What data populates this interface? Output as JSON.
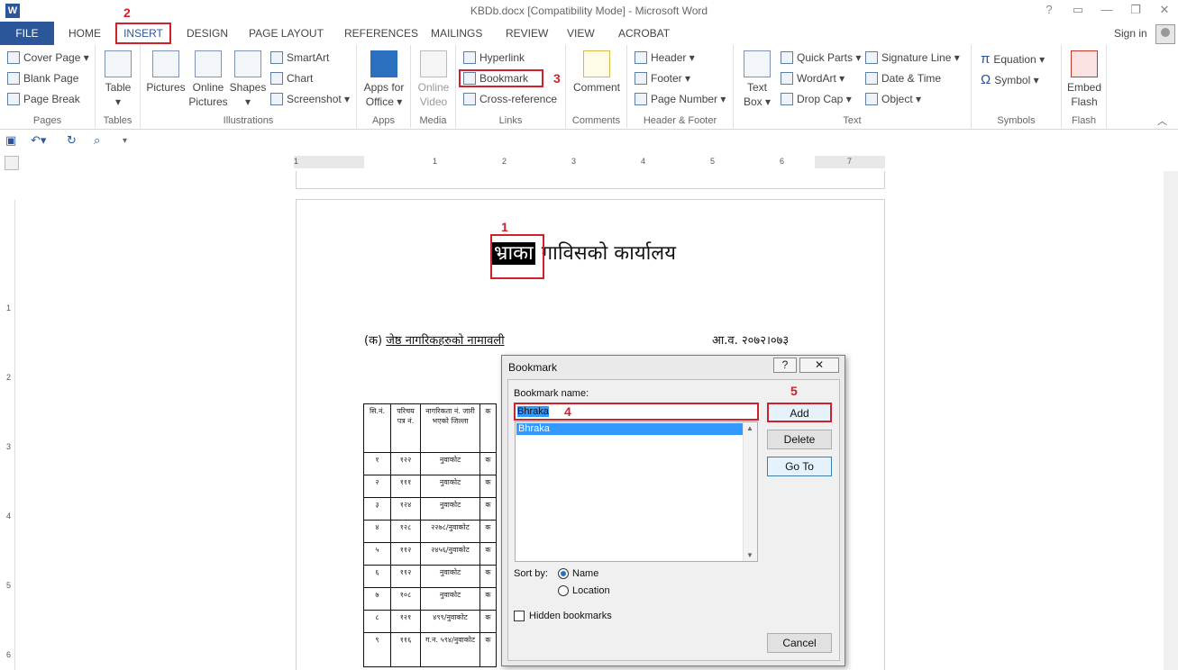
{
  "window": {
    "title": "KBDb.docx [Compatibility Mode] - Microsoft Word",
    "app_icon": "W",
    "controls": [
      "?",
      "▭",
      "—",
      "❐",
      "✕"
    ]
  },
  "tabs": {
    "file": "FILE",
    "items": [
      "HOME",
      "INSERT",
      "DESIGN",
      "PAGE LAYOUT",
      "REFERENCES",
      "MAILINGS",
      "REVIEW",
      "VIEW",
      "ACROBAT"
    ],
    "active": "INSERT",
    "signin": "Sign in"
  },
  "ribbon": {
    "pages": {
      "label": "Pages",
      "items": [
        "Cover Page ▾",
        "Blank Page",
        "Page Break"
      ]
    },
    "tables": {
      "label": "Tables",
      "table": "Table"
    },
    "illustrations": {
      "label": "Illustrations",
      "pictures": "Pictures",
      "online_pictures": "Online Pictures",
      "shapes": "Shapes",
      "smartart": "SmartArt",
      "chart": "Chart",
      "screenshot": "Screenshot ▾"
    },
    "apps": {
      "label": "Apps",
      "apps_for_office": "Apps for Office ▾"
    },
    "media": {
      "label": "Media",
      "online_video": "Online Video"
    },
    "links": {
      "label": "Links",
      "hyperlink": "Hyperlink",
      "bookmark": "Bookmark",
      "cross_reference": "Cross-reference"
    },
    "comments": {
      "label": "Comments",
      "comment": "Comment"
    },
    "header_footer": {
      "label": "Header & Footer",
      "header": "Header ▾",
      "footer": "Footer ▾",
      "page_number": "Page Number ▾"
    },
    "text": {
      "label": "Text",
      "text_box": "Text Box ▾",
      "quick_parts": "Quick Parts ▾",
      "wordart": "WordArt ▾",
      "drop_cap": "Drop Cap ▾",
      "signature_line": "Signature Line ▾",
      "date_time": "Date & Time",
      "object": "Object ▾"
    },
    "symbols": {
      "label": "Symbols",
      "equation": "Equation ▾",
      "symbol": "Symbol ▾"
    },
    "flash": {
      "label": "Flash",
      "embed_flash": "Embed Flash"
    }
  },
  "annotations": {
    "a1": "1",
    "a2": "2",
    "a3": "3",
    "a4": "4",
    "a5": "5"
  },
  "ruler": {
    "h": [
      "1",
      "1",
      "2",
      "3",
      "4",
      "5",
      "6",
      "7"
    ],
    "v": [
      "1",
      "2",
      "3",
      "4",
      "5",
      "6"
    ]
  },
  "document": {
    "heading_selected": "भ्राका",
    "heading_rest": " गाविसको कार्यालय",
    "subheading_prefix": "(क) ",
    "subheading": "जेष्ठ नागरिकहरुको नामावली",
    "date": "आ.व. २०७२।०७३",
    "table_header": [
      "सि.नं.",
      "परिचय पत्र नं.",
      "नागरिकता नं. जारी भएको जिल्ला",
      "क"
    ],
    "table_rows": [
      [
        "१",
        "१२२",
        "नुवाकोट",
        "क"
      ],
      [
        "२",
        "१११",
        "नुवाकोट",
        "क"
      ],
      [
        "३",
        "१२४",
        "नुवाकोट",
        "क"
      ],
      [
        "४",
        "१२८",
        "२२७८/नुवाकोट",
        "क"
      ],
      [
        "५",
        "११२",
        "२४५६/नुवाकोट",
        "क"
      ],
      [
        "६",
        "११२",
        "नुवाकोट",
        "क"
      ],
      [
        "७",
        "१०८",
        "नुवाकोट",
        "क"
      ],
      [
        "८",
        "१२१",
        "४९९/नुवाकोट",
        "क"
      ],
      [
        "९",
        "११६",
        "ग.न. ५९४/नुवाकोट",
        "क"
      ]
    ]
  },
  "dialog": {
    "title": "Bookmark",
    "help": "?",
    "close": "✕",
    "name_label": "Bookmark name:",
    "name_value": "Bhraka",
    "list": [
      "Bhraka"
    ],
    "sort_by": "Sort by:",
    "sort_name": "Name",
    "sort_location": "Location",
    "sort_selected": "Name",
    "hidden": "Hidden bookmarks",
    "hidden_checked": false,
    "add": "Add",
    "delete": "Delete",
    "goto": "Go To",
    "cancel": "Cancel"
  },
  "colors": {
    "accent": "#2b579a",
    "annotation": "#d0202a",
    "selection": "#3399ff"
  }
}
